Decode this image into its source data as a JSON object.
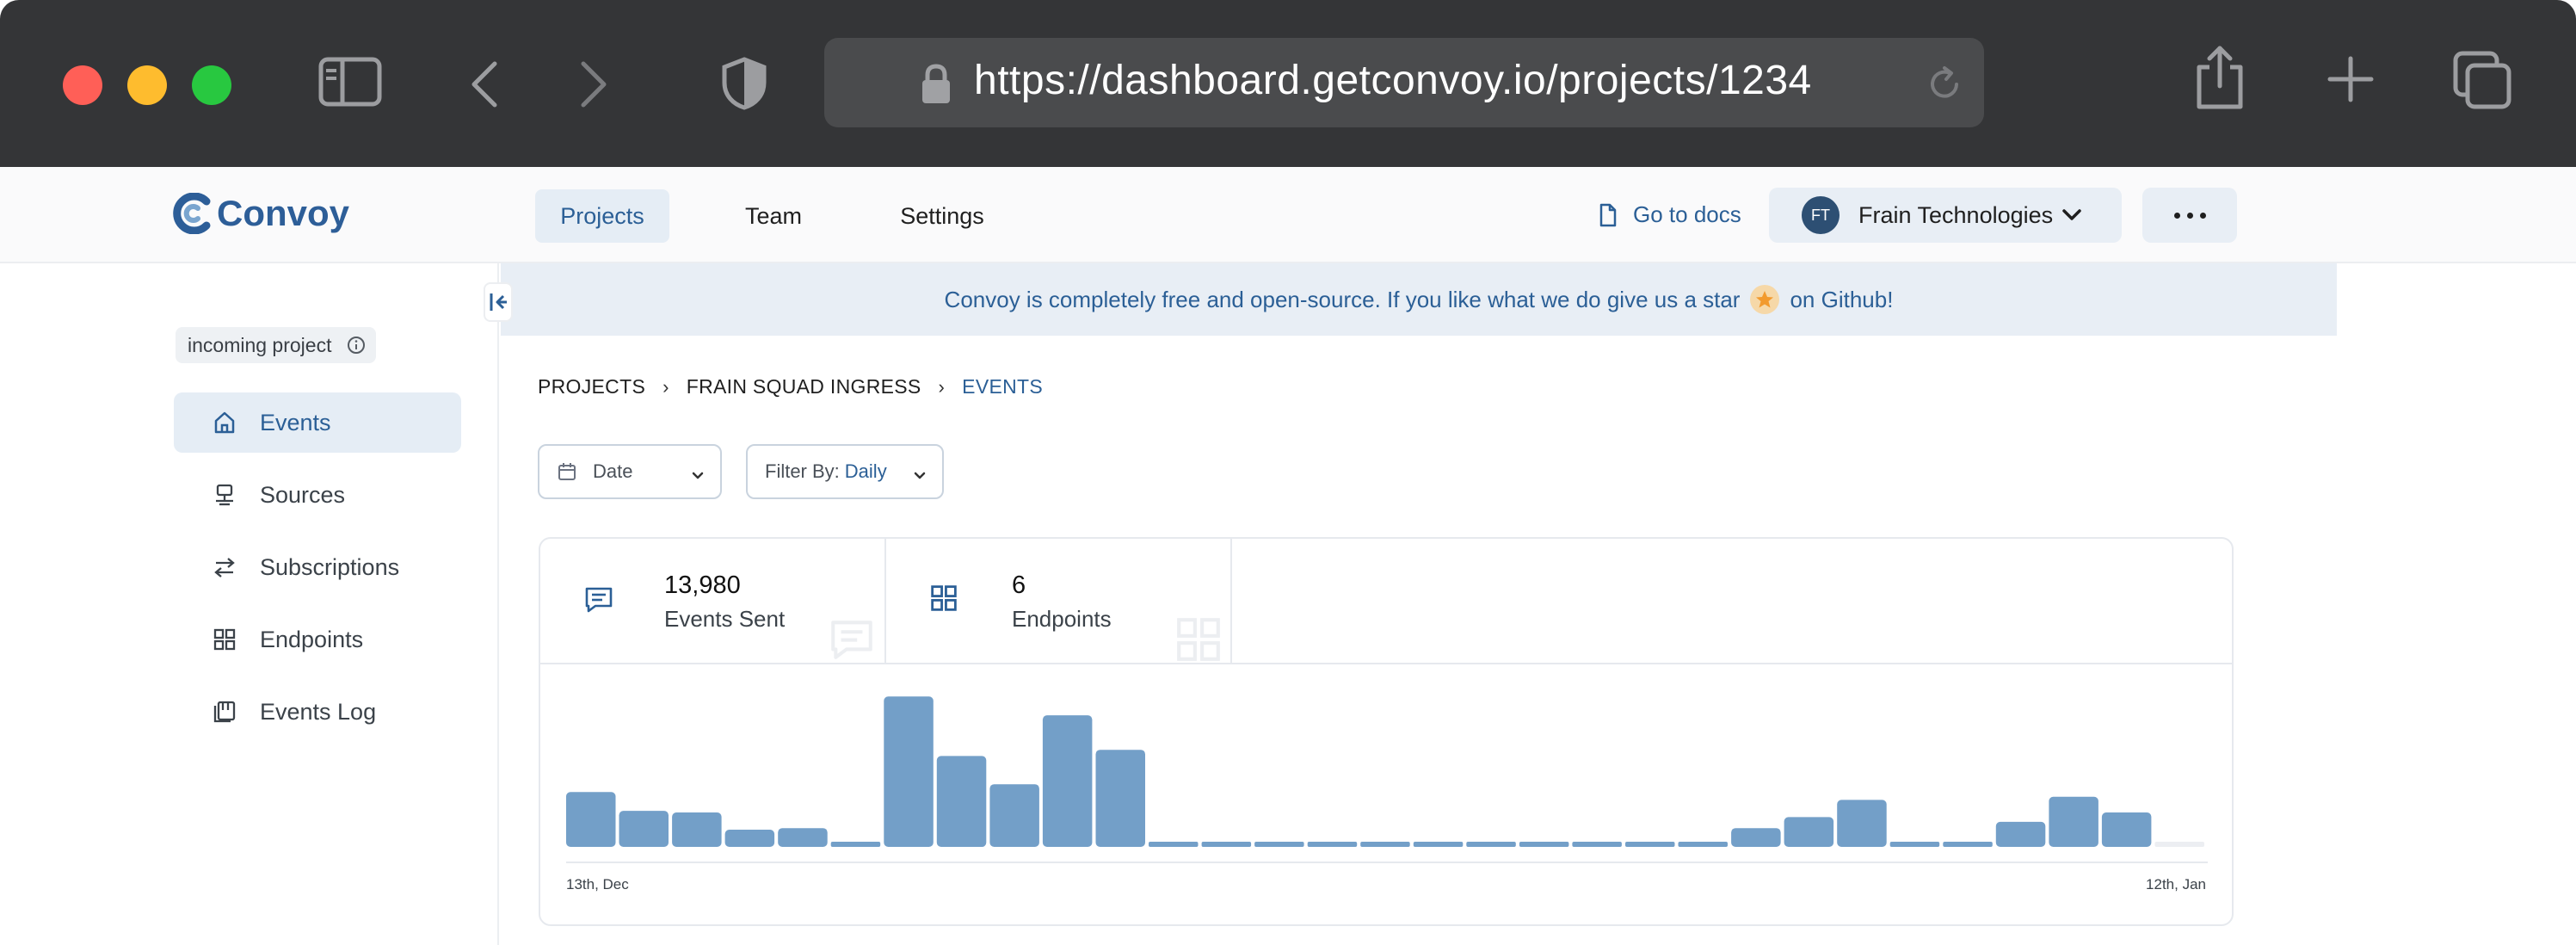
{
  "browser": {
    "url": "https://dashboard.getconvoy.io/projects/1234"
  },
  "topnav": {
    "logo_text": "Convoy",
    "tabs": [
      {
        "label": "Projects",
        "active": true
      },
      {
        "label": "Team",
        "active": false
      },
      {
        "label": "Settings",
        "active": false
      }
    ],
    "docs_label": "Go to docs",
    "org_initials": "FT",
    "org_name": "Frain Technologies"
  },
  "sidebar": {
    "project_badge": "incoming project",
    "items": [
      {
        "label": "Events",
        "icon": "home-icon",
        "active": true
      },
      {
        "label": "Sources",
        "icon": "sources-icon",
        "active": false
      },
      {
        "label": "Subscriptions",
        "icon": "arrows-swap-icon",
        "active": false
      },
      {
        "label": "Endpoints",
        "icon": "grid-icon",
        "active": false
      },
      {
        "label": "Events Log",
        "icon": "log-icon",
        "active": false
      }
    ]
  },
  "banner": {
    "text_before": "Convoy is completely free and open-source. If you like what we do give us a star",
    "text_after": "on Github!"
  },
  "breadcrumb": {
    "items": [
      "PROJECTS",
      "FRAIN SQUAD INGRESS",
      "EVENTS"
    ]
  },
  "filters": {
    "date_label": "Date",
    "filter_prefix": "Filter By:",
    "filter_value": "Daily"
  },
  "stats": {
    "events_sent_value": "13,980",
    "events_sent_label": "Events Sent",
    "endpoints_value": "6",
    "endpoints_label": "Endpoints"
  },
  "colors": {
    "bar": "#739fc8",
    "bar_empty": "#eceef2",
    "accent": "#2b5f96"
  },
  "chart_data": {
    "type": "bar",
    "x_start_label": "13th, Dec",
    "x_end_label": "12th, Jan",
    "values": [
      35,
      23,
      22,
      11,
      12,
      3,
      96,
      58,
      40,
      84,
      62,
      3,
      3,
      3,
      3,
      3,
      3,
      3,
      3,
      3,
      3,
      3,
      12,
      19,
      30,
      3,
      3,
      16,
      32,
      22,
      0
    ],
    "ylim": [
      0,
      100
    ],
    "title": "",
    "xlabel": "",
    "ylabel": ""
  }
}
